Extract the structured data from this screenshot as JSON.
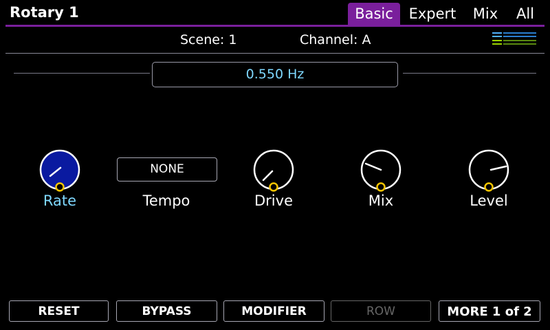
{
  "header": {
    "title": "Rotary 1",
    "tabs": [
      {
        "label": "Basic",
        "active": true
      },
      {
        "label": "Expert",
        "active": false
      },
      {
        "label": "Mix",
        "active": false
      },
      {
        "label": "All",
        "active": false
      }
    ]
  },
  "scene": {
    "scene_label": "Scene: 1",
    "channel_label": "Channel: A"
  },
  "value_display": "0.550 Hz",
  "knobs": [
    {
      "label": "Rate",
      "selected": true
    },
    {
      "label": "Tempo",
      "value": "NONE"
    },
    {
      "label": "Drive",
      "selected": false
    },
    {
      "label": "Mix",
      "selected": false
    },
    {
      "label": "Level",
      "selected": false
    }
  ],
  "buttons": [
    {
      "label": "RESET",
      "enabled": true
    },
    {
      "label": "BYPASS",
      "enabled": true
    },
    {
      "label": "MODIFIER",
      "enabled": true
    },
    {
      "label": "ROW",
      "enabled": false
    },
    {
      "label": "MORE 1 of 2",
      "enabled": true
    }
  ],
  "colors": {
    "accent": "#7a1f9c",
    "value_text": "#7fd8ff",
    "knob_selected_fill": "#0a1aa0",
    "knob_marker": "#f5c400",
    "meter_green": "#9ad400",
    "meter_blue": "#4fb3ff"
  }
}
